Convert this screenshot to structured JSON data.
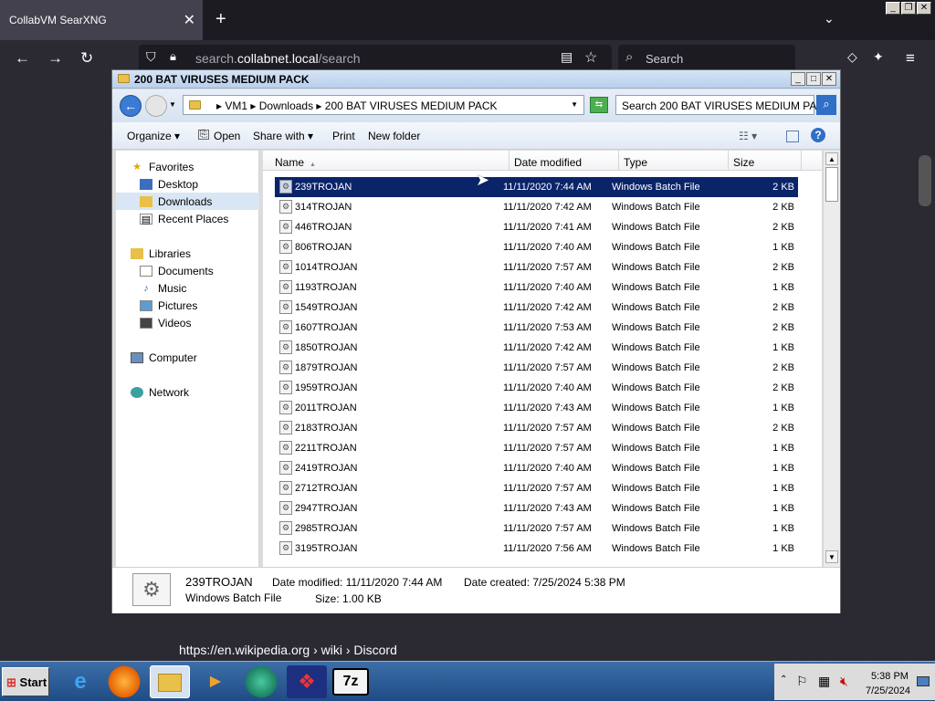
{
  "browser": {
    "tab_title": "CollabVM SearXNG",
    "tab_close": "✕",
    "new_tab": "+",
    "tab_list": "⌄",
    "url_prefix": "search.",
    "url_domain": "collabnet.local",
    "url_path": "/search",
    "search_placeholder": "Search",
    "nav_back": "←",
    "nav_forward": "→",
    "nav_reload": "↻"
  },
  "vm_controls": [
    "_",
    "❐",
    "✕"
  ],
  "explorer": {
    "title": "200 BAT VIRUSES MEDIUM PACK",
    "address_segments": "▸  VM1  ▸  Downloads  ▸  200 BAT VIRUSES MEDIUM PACK",
    "search_placeholder": "Search 200 BAT VIRUSES MEDIUM PACK",
    "toolbar": {
      "organize": "Organize ▾",
      "open": "Open",
      "share": "Share with ▾",
      "print": "Print",
      "new_folder": "New folder",
      "help": "?"
    },
    "nav": {
      "favorites": "Favorites",
      "desktop": "Desktop",
      "downloads": "Downloads",
      "recent": "Recent Places",
      "libraries": "Libraries",
      "documents": "Documents",
      "music": "Music",
      "pictures": "Pictures",
      "videos": "Videos",
      "computer": "Computer",
      "network": "Network"
    },
    "columns": {
      "name": "Name",
      "date": "Date modified",
      "type": "Type",
      "size": "Size"
    },
    "files": [
      {
        "name": "239TROJAN",
        "date": "11/11/2020 7:44 AM",
        "type": "Windows Batch File",
        "size": "2 KB"
      },
      {
        "name": "314TROJAN",
        "date": "11/11/2020 7:42 AM",
        "type": "Windows Batch File",
        "size": "2 KB"
      },
      {
        "name": "446TROJAN",
        "date": "11/11/2020 7:41 AM",
        "type": "Windows Batch File",
        "size": "2 KB"
      },
      {
        "name": "806TROJAN",
        "date": "11/11/2020 7:40 AM",
        "type": "Windows Batch File",
        "size": "1 KB"
      },
      {
        "name": "1014TROJAN",
        "date": "11/11/2020 7:57 AM",
        "type": "Windows Batch File",
        "size": "2 KB"
      },
      {
        "name": "1193TROJAN",
        "date": "11/11/2020 7:40 AM",
        "type": "Windows Batch File",
        "size": "1 KB"
      },
      {
        "name": "1549TROJAN",
        "date": "11/11/2020 7:42 AM",
        "type": "Windows Batch File",
        "size": "2 KB"
      },
      {
        "name": "1607TROJAN",
        "date": "11/11/2020 7:53 AM",
        "type": "Windows Batch File",
        "size": "2 KB"
      },
      {
        "name": "1850TROJAN",
        "date": "11/11/2020 7:42 AM",
        "type": "Windows Batch File",
        "size": "1 KB"
      },
      {
        "name": "1879TROJAN",
        "date": "11/11/2020 7:57 AM",
        "type": "Windows Batch File",
        "size": "2 KB"
      },
      {
        "name": "1959TROJAN",
        "date": "11/11/2020 7:40 AM",
        "type": "Windows Batch File",
        "size": "2 KB"
      },
      {
        "name": "2011TROJAN",
        "date": "11/11/2020 7:43 AM",
        "type": "Windows Batch File",
        "size": "1 KB"
      },
      {
        "name": "2183TROJAN",
        "date": "11/11/2020 7:57 AM",
        "type": "Windows Batch File",
        "size": "2 KB"
      },
      {
        "name": "2211TROJAN",
        "date": "11/11/2020 7:57 AM",
        "type": "Windows Batch File",
        "size": "1 KB"
      },
      {
        "name": "2419TROJAN",
        "date": "11/11/2020 7:40 AM",
        "type": "Windows Batch File",
        "size": "1 KB"
      },
      {
        "name": "2712TROJAN",
        "date": "11/11/2020 7:57 AM",
        "type": "Windows Batch File",
        "size": "1 KB"
      },
      {
        "name": "2947TROJAN",
        "date": "11/11/2020 7:43 AM",
        "type": "Windows Batch File",
        "size": "1 KB"
      },
      {
        "name": "2985TROJAN",
        "date": "11/11/2020 7:57 AM",
        "type": "Windows Batch File",
        "size": "1 KB"
      },
      {
        "name": "3195TROJAN",
        "date": "11/11/2020 7:56 AM",
        "type": "Windows Batch File",
        "size": "1 KB"
      }
    ],
    "details": {
      "name": "239TROJAN",
      "type": "Windows Batch File",
      "modified": "Date modified:  11/11/2020 7:44 AM",
      "created": "Date created:  7/25/2024 5:38 PM",
      "size": "Size:  1.00 KB"
    }
  },
  "page": {
    "wiki_link": "https://en.wikipedia.org  › wiki › Discord"
  },
  "taskbar": {
    "start": "Start",
    "time": "5:38 PM",
    "date": "7/25/2024",
    "apps": [
      "internet-explorer",
      "firefox",
      "explorer",
      "media-player",
      "app-green",
      "app-red",
      "7zip"
    ]
  },
  "colors": {
    "selection": "#0a246a",
    "taskbar": "#2b5a94"
  }
}
